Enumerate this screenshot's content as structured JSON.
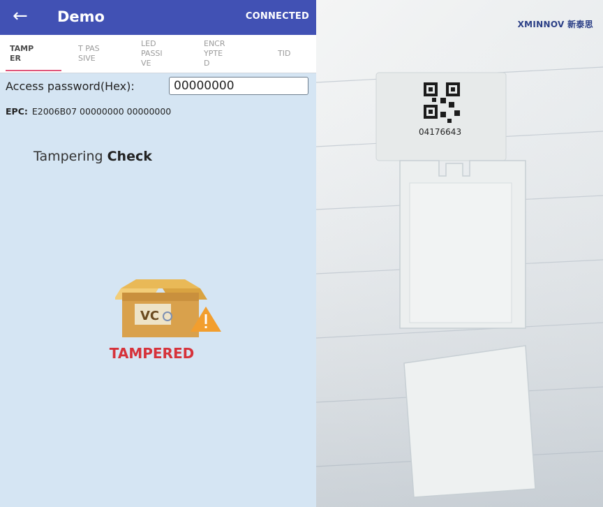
{
  "app_bar": {
    "back_icon": "arrow-left-icon",
    "title": "Demo",
    "status": "CONNECTED",
    "color": "#4151b4"
  },
  "tabs": [
    {
      "label": "TAMP\nER",
      "active": true
    },
    {
      "label": "T PAS\nSIVE",
      "active": false
    },
    {
      "label": "LED\nPASSI\nVE",
      "active": false
    },
    {
      "label": "ENCR\nYPTE\nD",
      "active": false
    },
    {
      "label": "TID",
      "active": false
    }
  ],
  "tab_indicator_color": "#e0567a",
  "access_password": {
    "label": "Access password(Hex):",
    "value": "00000000"
  },
  "epc": {
    "label": "EPC:",
    "value": "E2006B07 00000000 00000000"
  },
  "check_heading": {
    "prefix": "Tampering",
    "bold": "Check"
  },
  "result": {
    "icon": "tampered-box-warning-icon",
    "box_text": "VC",
    "status": "TAMPERED",
    "color": "#d6323a"
  },
  "photo": {
    "brand": "XMINNOV 新泰思",
    "tag_id": "04176643"
  }
}
